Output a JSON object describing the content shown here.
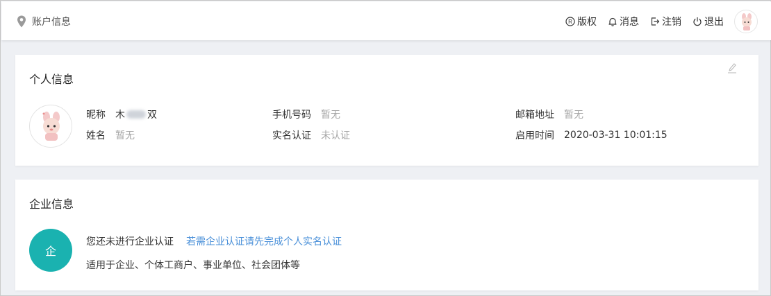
{
  "header": {
    "breadcrumb": "账户信息",
    "actions": {
      "copyright": "版权",
      "messages": "消息",
      "logout": "注销",
      "exit": "退出"
    }
  },
  "personal": {
    "title": "个人信息",
    "nickname_label": "昵称",
    "nickname_prefix": "木",
    "nickname_suffix": "双",
    "name_label": "姓名",
    "name_value": "暂无",
    "phone_label": "手机号码",
    "phone_value": "暂无",
    "realname_label": "实名认证",
    "realname_value": "未认证",
    "email_label": "邮箱地址",
    "email_value": "暂无",
    "enabled_label": "启用时间",
    "enabled_value": "2020-03-31 10:01:15"
  },
  "company": {
    "title": "企业信息",
    "badge": "企",
    "status_text": "您还未进行企业认证",
    "action_link": "若需企业认证请先完成个人实名认证",
    "description": "适用于企业、个体工商户、事业单位、社会团体等"
  },
  "colors": {
    "accent": "#1ab2b0",
    "link": "#4a90d9",
    "muted": "#a6a6a6",
    "page_bg": "#eef0f4"
  },
  "icons": [
    "location-pin-icon",
    "registered-icon",
    "bell-icon",
    "logout-icon",
    "power-icon",
    "edit-pencil-icon"
  ]
}
